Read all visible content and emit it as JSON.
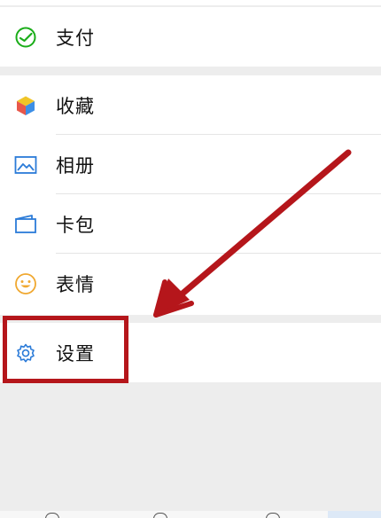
{
  "menu": {
    "payment": {
      "label": "支付",
      "icon": "wechat-pay-icon"
    },
    "favorites": {
      "label": "收藏",
      "icon": "favorites-cube-icon"
    },
    "album": {
      "label": "相册",
      "icon": "album-picture-icon"
    },
    "cards": {
      "label": "卡包",
      "icon": "card-wallet-icon"
    },
    "stickers": {
      "label": "表情",
      "icon": "smiley-face-icon"
    },
    "settings": {
      "label": "设置",
      "icon": "gear-icon"
    }
  },
  "colors": {
    "highlight": "#b5161b",
    "background": "#ededed",
    "wechat_green": "#1aad19",
    "icon_blue": "#2b7bd8"
  }
}
